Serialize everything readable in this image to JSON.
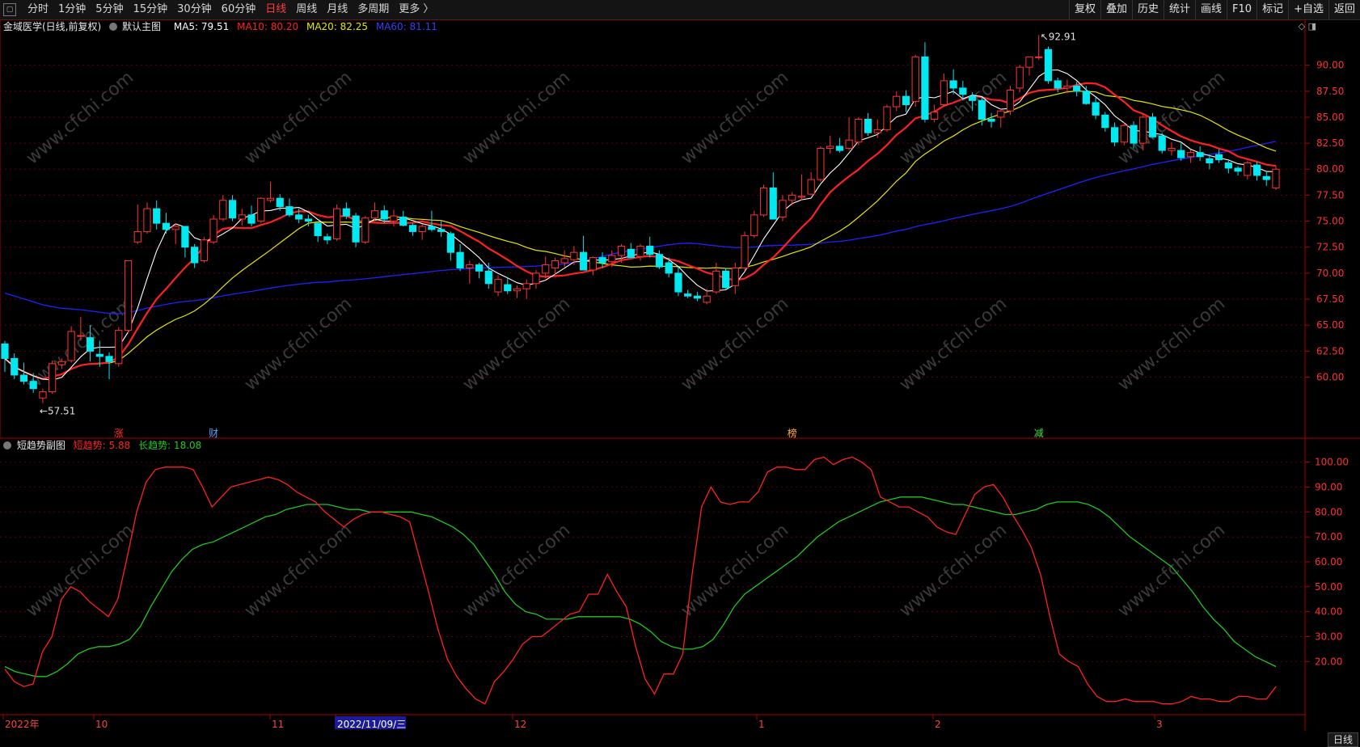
{
  "toolbar": {
    "periods": [
      "分时",
      "1分钟",
      "5分钟",
      "15分钟",
      "30分钟",
      "60分钟",
      "日线",
      "周线",
      "月线",
      "多周期",
      "更多 〉"
    ],
    "active_period": "日线",
    "tools": [
      "复权",
      "叠加",
      "历史",
      "统计",
      "画线",
      "F10",
      "标记",
      "+自选",
      "返回"
    ]
  },
  "main_info": {
    "stock": "金域医学(日线,前复权)",
    "indicator": "默认主图",
    "ma5": "MA5: 79.51",
    "ma10": "MA10: 80.20",
    "ma20": "MA20: 82.25",
    "ma60": "MA60: 81.11"
  },
  "sub_info": {
    "name": "短趋势副图",
    "short": "短趋势: 5.88",
    "long": "长趋势: 18.08"
  },
  "annotations": {
    "high": "92.91",
    "low": "57.51",
    "markers": [
      "涨",
      "财",
      "榜",
      "减"
    ]
  },
  "date_labels": [
    "2022年",
    "10",
    "11",
    "2022/11/09/三",
    "12",
    "1",
    "2",
    "3"
  ],
  "bottom_tag": "日线",
  "watermark": "www.cfchi.com",
  "colors": {
    "bg": "#000000",
    "up": "#ff3232",
    "down": "#00e8f0",
    "ma5": "#ffffff",
    "ma10": "#ff2020",
    "ma20": "#e6e600",
    "ma60": "#2020ff",
    "short": "#ff2020",
    "long": "#1ec81e",
    "grid": "#5a0000",
    "axis": "#aa0000"
  },
  "chart_data": [
    {
      "type": "candlestick",
      "title": "金域医学(日线,前复权)",
      "ylim": [
        56,
        93
      ],
      "y_ticks": [
        60,
        62.5,
        65,
        67.5,
        70,
        72.5,
        75,
        77.5,
        80,
        82.5,
        85,
        87.5,
        90
      ],
      "y_tick_labels": [
        "60.00",
        "62.50",
        "65.00",
        "67.50",
        "70.00",
        "72.50",
        "75.00",
        "77.50",
        "80.00",
        "82.50",
        "85.00",
        "87.50",
        "90.00"
      ],
      "candles": [
        [
          63.2,
          63.5,
          60.5,
          61.8
        ],
        [
          61.8,
          62.3,
          59.8,
          60.2
        ],
        [
          60.2,
          61.4,
          59.3,
          59.6
        ],
        [
          59.6,
          60.4,
          58.5,
          58.9
        ],
        [
          58.0,
          58.9,
          57.5,
          58.6
        ],
        [
          58.6,
          61.6,
          58.4,
          61.3
        ],
        [
          61.2,
          61.8,
          60.8,
          61.5
        ],
        [
          61.6,
          64.9,
          61.4,
          64.4
        ],
        [
          64.0,
          65.8,
          63.5,
          64.0
        ],
        [
          63.8,
          65.0,
          61.5,
          62.5
        ],
        [
          62.2,
          63.5,
          61.0,
          62.0
        ],
        [
          62.0,
          62.4,
          59.8,
          61.5
        ],
        [
          61.3,
          64.8,
          61.0,
          64.5
        ],
        [
          64.5,
          71.2,
          64.2,
          71.2
        ],
        [
          73.0,
          76.6,
          72.8,
          74.0
        ],
        [
          74.0,
          76.8,
          73.8,
          76.2
        ],
        [
          76.2,
          77.0,
          74.2,
          74.8
        ],
        [
          74.8,
          75.8,
          73.8,
          74.2
        ],
        [
          74.2,
          74.8,
          72.8,
          74.5
        ],
        [
          74.5,
          74.5,
          71.5,
          72.5
        ],
        [
          72.5,
          72.8,
          70.5,
          71.0
        ],
        [
          71.2,
          73.5,
          71.0,
          73.2
        ],
        [
          73.0,
          75.6,
          72.8,
          75.2
        ],
        [
          75.2,
          77.5,
          75.0,
          77.0
        ],
        [
          77.0,
          77.5,
          75.0,
          75.3
        ],
        [
          75.2,
          76.2,
          74.6,
          75.6
        ],
        [
          75.6,
          76.5,
          74.5,
          74.8
        ],
        [
          75.0,
          77.3,
          74.8,
          77.2
        ],
        [
          77.0,
          78.8,
          76.8,
          77.2
        ],
        [
          77.2,
          77.6,
          76.0,
          76.4
        ],
        [
          76.4,
          77.2,
          75.4,
          75.6
        ],
        [
          75.6,
          76.2,
          74.8,
          75.2
        ],
        [
          75.2,
          75.6,
          74.5,
          75.0
        ],
        [
          74.8,
          74.8,
          73.0,
          73.6
        ],
        [
          73.5,
          73.8,
          72.8,
          73.2
        ],
        [
          73.3,
          76.6,
          73.1,
          76.2
        ],
        [
          76.2,
          76.8,
          75.2,
          75.5
        ],
        [
          75.5,
          75.8,
          72.5,
          73.0
        ],
        [
          73.0,
          75.5,
          72.8,
          75.3
        ],
        [
          75.3,
          76.8,
          75.0,
          76.0
        ],
        [
          76.0,
          76.5,
          74.8,
          75.2
        ],
        [
          75.0,
          76.1,
          74.5,
          75.5
        ],
        [
          75.4,
          76.0,
          74.5,
          74.6
        ],
        [
          74.6,
          74.8,
          73.6,
          74.0
        ],
        [
          74.0,
          74.7,
          73.2,
          74.5
        ],
        [
          74.5,
          76.0,
          74.0,
          74.2
        ],
        [
          74.2,
          75.0,
          73.5,
          74.0
        ],
        [
          73.8,
          74.0,
          71.2,
          72.0
        ],
        [
          72.0,
          72.8,
          70.2,
          70.5
        ],
        [
          70.5,
          71.2,
          69.0,
          70.8
        ],
        [
          70.8,
          71.0,
          69.5,
          70.2
        ],
        [
          70.2,
          71.0,
          68.5,
          69.0
        ],
        [
          68.2,
          69.8,
          67.8,
          69.4
        ],
        [
          68.9,
          69.6,
          68.0,
          68.3
        ],
        [
          68.3,
          68.8,
          67.6,
          68.5
        ],
        [
          68.5,
          69.4,
          67.5,
          69.0
        ],
        [
          69.0,
          70.3,
          68.5,
          70.0
        ],
        [
          70.0,
          71.6,
          69.5,
          70.8
        ],
        [
          70.5,
          71.5,
          69.8,
          71.2
        ],
        [
          71.0,
          72.2,
          70.6,
          71.4
        ],
        [
          71.3,
          72.6,
          70.8,
          72.0
        ],
        [
          72.0,
          73.6,
          70.3,
          70.3
        ],
        [
          70.3,
          71.6,
          69.8,
          71.5
        ],
        [
          71.5,
          72.0,
          70.5,
          71.0
        ],
        [
          71.1,
          72.2,
          70.6,
          71.7
        ],
        [
          71.7,
          72.8,
          71.0,
          72.6
        ],
        [
          72.3,
          72.9,
          71.5,
          71.5
        ],
        [
          71.6,
          72.8,
          71.2,
          72.6
        ],
        [
          72.6,
          73.5,
          71.5,
          71.8
        ],
        [
          71.8,
          72.2,
          70.4,
          70.6
        ],
        [
          71.0,
          71.5,
          69.6,
          70.0
        ],
        [
          70.0,
          70.6,
          67.8,
          68.2
        ],
        [
          68.0,
          68.4,
          67.6,
          67.8
        ],
        [
          67.8,
          68.2,
          67.3,
          67.6
        ],
        [
          67.2,
          68.5,
          67.0,
          67.8
        ],
        [
          68.2,
          71.0,
          68.0,
          70.2
        ],
        [
          70.2,
          70.5,
          68.5,
          68.6
        ],
        [
          68.8,
          71.0,
          68.0,
          70.5
        ],
        [
          70.5,
          74.0,
          70.2,
          73.6
        ],
        [
          73.6,
          76.0,
          73.4,
          75.6
        ],
        [
          75.6,
          78.5,
          75.4,
          78.2
        ],
        [
          78.2,
          79.7,
          75.2,
          75.2
        ],
        [
          75.4,
          77.5,
          75.0,
          77.0
        ],
        [
          77.0,
          77.8,
          76.5,
          77.5
        ],
        [
          77.3,
          79.5,
          77.0,
          77.4
        ],
        [
          77.6,
          79.7,
          77.5,
          79.0
        ],
        [
          79.0,
          82.2,
          78.8,
          82.0
        ],
        [
          82.0,
          83.2,
          81.5,
          82.2
        ],
        [
          82.2,
          83.0,
          81.6,
          81.8
        ],
        [
          82.0,
          85.0,
          81.8,
          82.8
        ],
        [
          82.6,
          85.0,
          82.3,
          84.8
        ],
        [
          84.8,
          85.4,
          83.2,
          83.5
        ],
        [
          83.5,
          84.8,
          83.0,
          83.8
        ],
        [
          83.8,
          86.2,
          83.6,
          86.0
        ],
        [
          86.0,
          87.5,
          85.6,
          87.0
        ],
        [
          87.0,
          87.6,
          85.5,
          86.2
        ],
        [
          86.5,
          91.0,
          86.0,
          90.8
        ],
        [
          90.8,
          92.2,
          84.5,
          84.8
        ],
        [
          84.8,
          86.2,
          84.5,
          85.5
        ],
        [
          86.2,
          89.2,
          86.0,
          88.5
        ],
        [
          88.5,
          89.6,
          87.2,
          87.8
        ],
        [
          87.8,
          88.5,
          86.6,
          87.2
        ],
        [
          87.0,
          87.4,
          85.6,
          86.6
        ],
        [
          86.6,
          86.9,
          84.2,
          84.8
        ],
        [
          84.8,
          85.4,
          84.0,
          84.6
        ],
        [
          85.0,
          85.8,
          84.0,
          85.6
        ],
        [
          85.6,
          88.0,
          85.2,
          87.6
        ],
        [
          87.8,
          90.0,
          87.4,
          89.8
        ],
        [
          89.8,
          90.8,
          89.0,
          90.8
        ],
        [
          90.8,
          92.9,
          90.5,
          90.8
        ],
        [
          91.5,
          91.8,
          88.2,
          88.5
        ],
        [
          88.5,
          88.8,
          87.4,
          87.8
        ],
        [
          87.8,
          88.6,
          87.3,
          88.0
        ],
        [
          88.0,
          88.4,
          87.0,
          87.5
        ],
        [
          87.5,
          88.0,
          86.2,
          86.3
        ],
        [
          86.4,
          86.9,
          84.8,
          85.2
        ],
        [
          85.2,
          85.5,
          83.6,
          84.0
        ],
        [
          84.0,
          84.5,
          82.2,
          82.6
        ],
        [
          82.6,
          84.5,
          82.3,
          84.2
        ],
        [
          84.2,
          84.6,
          82.0,
          82.5
        ],
        [
          82.5,
          85.2,
          81.8,
          85.0
        ],
        [
          85.0,
          85.4,
          83.0,
          83.1
        ],
        [
          83.2,
          83.5,
          81.5,
          81.8
        ],
        [
          81.8,
          82.6,
          81.3,
          82.0
        ],
        [
          81.8,
          82.5,
          80.8,
          81.1
        ],
        [
          81.2,
          81.9,
          80.6,
          81.6
        ],
        [
          81.6,
          82.2,
          80.8,
          81.2
        ],
        [
          81.0,
          81.4,
          80.0,
          80.6
        ],
        [
          81.4,
          81.9,
          80.6,
          80.9
        ],
        [
          80.6,
          80.9,
          79.6,
          80.1
        ],
        [
          80.1,
          80.3,
          79.4,
          79.8
        ],
        [
          79.4,
          80.8,
          79.0,
          80.6
        ],
        [
          80.4,
          80.7,
          78.9,
          79.4
        ],
        [
          79.3,
          79.8,
          78.4,
          79.0
        ],
        [
          78.2,
          80.3,
          78.0,
          80.0
        ]
      ],
      "ma_series": [
        {
          "name": "MA5",
          "color": "#ffffff"
        },
        {
          "name": "MA10",
          "color": "#ff2020"
        },
        {
          "name": "MA20",
          "color": "#e6e600"
        },
        {
          "name": "MA60",
          "color": "#2020ff",
          "values_pre": [
            71.2,
            70.9,
            70.6,
            70.3,
            70.0,
            69.7,
            69.4,
            69.1,
            68.8,
            68.6,
            68.3,
            68.0,
            67.8,
            67.6,
            67.4,
            67.3,
            67.2,
            67.2,
            67.1,
            67.1,
            67.1,
            67.1,
            67.1,
            67.2,
            67.2,
            67.3
          ]
        }
      ]
    },
    {
      "type": "line",
      "title": "短趋势副图",
      "ylim": [
        0,
        107
      ],
      "y_ticks": [
        20,
        30,
        40,
        50,
        60,
        70,
        80,
        90,
        100
      ],
      "y_tick_labels": [
        "20.00",
        "30.00",
        "40.00",
        "50.00",
        "60.00",
        "70.00",
        "80.00",
        "90.00",
        "100.00"
      ],
      "series": [
        {
          "name": "短趋势",
          "color": "#ff2020",
          "values": [
            17,
            12,
            10,
            11,
            24,
            30,
            45,
            50,
            48,
            44,
            41,
            38,
            45,
            62,
            80,
            92,
            97,
            98,
            98,
            98,
            97,
            90,
            82,
            86,
            90,
            91,
            92,
            93,
            94,
            93,
            91,
            88,
            86,
            84,
            80,
            77,
            74,
            77,
            79,
            80,
            80,
            79,
            78,
            76,
            62,
            48,
            33,
            21,
            14,
            9,
            5,
            3,
            12,
            16,
            21,
            27,
            30,
            30,
            33,
            36,
            39,
            40,
            47,
            47,
            55,
            48,
            42,
            26,
            13,
            7,
            15,
            15,
            23,
            55,
            82,
            90,
            84,
            83,
            84,
            84,
            88,
            96,
            98,
            98,
            97,
            97,
            101,
            102,
            99,
            101,
            102,
            100,
            97,
            86,
            84,
            82,
            82,
            80,
            78,
            74,
            72,
            71,
            79,
            87,
            90,
            91,
            86,
            79,
            73,
            66,
            55,
            38,
            23,
            20,
            18,
            11,
            6,
            4,
            4,
            5,
            4,
            4,
            4,
            3,
            3,
            4,
            6,
            5,
            5,
            4,
            4,
            6,
            6,
            5,
            5,
            10
          ]
        },
        {
          "name": "长趋势",
          "color": "#1ec81e",
          "values": [
            18,
            16,
            15,
            14,
            14,
            16,
            19,
            23,
            25,
            26,
            26,
            27,
            29,
            34,
            42,
            49,
            56,
            61,
            65,
            67,
            68,
            70,
            72,
            74,
            76,
            78,
            79,
            81,
            82,
            83,
            83,
            83,
            82,
            81,
            81,
            80,
            80,
            80,
            80,
            80,
            79,
            78,
            76,
            74,
            71,
            67,
            61,
            55,
            48,
            43,
            40,
            39,
            37,
            37,
            37,
            38,
            38,
            38,
            38,
            38,
            37,
            35,
            32,
            28,
            26,
            25,
            25,
            26,
            29,
            35,
            42,
            47,
            50,
            53,
            56,
            59,
            62,
            66,
            70,
            73,
            76,
            78,
            80,
            82,
            84,
            85,
            86,
            86,
            86,
            85,
            84,
            83,
            83,
            82,
            81,
            80,
            79,
            79,
            80,
            81,
            83,
            84,
            84,
            84,
            83,
            81,
            78,
            74,
            70,
            67,
            64,
            61,
            58,
            53,
            48,
            42,
            37,
            33,
            28,
            25,
            22,
            20,
            18
          ]
        }
      ]
    }
  ]
}
